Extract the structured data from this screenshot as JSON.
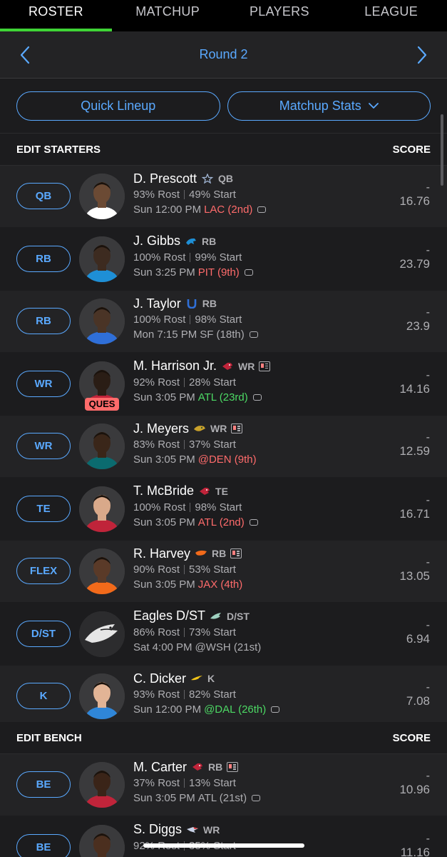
{
  "tabs": [
    {
      "label": "ROSTER",
      "active": true
    },
    {
      "label": "MATCHUP",
      "active": false
    },
    {
      "label": "PLAYERS",
      "active": false
    },
    {
      "label": "LEAGUE",
      "active": false
    }
  ],
  "round": {
    "title": "Round 2"
  },
  "actions": {
    "quick_lineup": "Quick Lineup",
    "matchup_stats": "Matchup Stats"
  },
  "starters_header": {
    "title": "EDIT STARTERS",
    "score": "SCORE"
  },
  "bench_header": {
    "title": "EDIT BENCH",
    "score": "SCORE"
  },
  "colors": {
    "accent": "#5aa9ff",
    "active_tab": "#3fd436",
    "red": "#ff6b6b",
    "green": "#4cd964"
  },
  "starters": [
    {
      "slot": "QB",
      "name": "D. Prescott",
      "team_icon": "cowboys-star-icon",
      "pos": "QB",
      "news": false,
      "rost": "93% Rost",
      "start": "49% Start",
      "time": "Sun 12:00 PM",
      "opp": "LAC (2nd)",
      "opp_color": "red",
      "controller": true,
      "live": "-",
      "proj": "16.76",
      "status": ""
    },
    {
      "slot": "RB",
      "name": "J. Gibbs",
      "team_icon": "lions-icon",
      "pos": "RB",
      "news": false,
      "rost": "100% Rost",
      "start": "99% Start",
      "time": "Sun 3:25 PM",
      "opp": "PIT (9th)",
      "opp_color": "red",
      "controller": true,
      "live": "-",
      "proj": "23.79",
      "status": ""
    },
    {
      "slot": "RB",
      "name": "J. Taylor",
      "team_icon": "colts-horseshoe-icon",
      "pos": "RB",
      "news": false,
      "rost": "100% Rost",
      "start": "98% Start",
      "time": "Mon 7:15 PM",
      "opp": "SF (18th)",
      "opp_color": "gray",
      "controller": true,
      "live": "-",
      "proj": "23.9",
      "status": ""
    },
    {
      "slot": "WR",
      "name": "M. Harrison Jr.",
      "team_icon": "cardinals-icon",
      "pos": "WR",
      "news": true,
      "rost": "92% Rost",
      "start": "28% Start",
      "time": "Sun 3:05 PM",
      "opp": "ATL (23rd)",
      "opp_color": "green",
      "controller": true,
      "live": "-",
      "proj": "14.16",
      "status": "QUES"
    },
    {
      "slot": "WR",
      "name": "J. Meyers",
      "team_icon": "jaguars-icon",
      "pos": "WR",
      "news": true,
      "rost": "83% Rost",
      "start": "37% Start",
      "time": "Sun 3:05 PM",
      "opp": "@DEN (9th)",
      "opp_color": "red",
      "controller": false,
      "live": "-",
      "proj": "12.59",
      "status": ""
    },
    {
      "slot": "TE",
      "name": "T. McBride",
      "team_icon": "cardinals-icon",
      "pos": "TE",
      "news": false,
      "rost": "100% Rost",
      "start": "98% Start",
      "time": "Sun 3:05 PM",
      "opp": "ATL (2nd)",
      "opp_color": "red",
      "controller": true,
      "live": "-",
      "proj": "16.71",
      "status": ""
    },
    {
      "slot": "FLEX",
      "name": "R. Harvey",
      "team_icon": "broncos-icon",
      "pos": "RB",
      "news": true,
      "rost": "90% Rost",
      "start": "53% Start",
      "time": "Sun 3:05 PM",
      "opp": "JAX (4th)",
      "opp_color": "red",
      "controller": false,
      "live": "-",
      "proj": "13.05",
      "status": ""
    },
    {
      "slot": "D/ST",
      "name": "Eagles D/ST",
      "team_icon": "eagles-icon",
      "pos": "D/ST",
      "news": false,
      "rost": "86% Rost",
      "start": "73% Start",
      "time": "Sat 4:00 PM",
      "opp": "@WSH (21st)",
      "opp_color": "gray",
      "controller": false,
      "live": "-",
      "proj": "6.94",
      "status": ""
    },
    {
      "slot": "K",
      "name": "C. Dicker",
      "team_icon": "chargers-bolt-icon",
      "pos": "K",
      "news": false,
      "rost": "93% Rost",
      "start": "82% Start",
      "time": "Sun 12:00 PM",
      "opp": "@DAL (26th)",
      "opp_color": "green",
      "controller": true,
      "live": "-",
      "proj": "7.08",
      "status": ""
    }
  ],
  "bench": [
    {
      "slot": "BE",
      "name": "M. Carter",
      "team_icon": "cardinals-icon",
      "pos": "RB",
      "news": true,
      "rost": "37% Rost",
      "start": "13% Start",
      "time": "Sun 3:05 PM",
      "opp": "ATL (21st)",
      "opp_color": "gray",
      "controller": true,
      "live": "-",
      "proj": "10.96",
      "status": ""
    },
    {
      "slot": "BE",
      "name": "S. Diggs",
      "team_icon": "patriots-icon",
      "pos": "WR",
      "news": false,
      "rost": "92% Rost",
      "start": "35% Start",
      "time": "",
      "opp": "",
      "opp_color": "gray",
      "controller": false,
      "live": "-",
      "proj": "11.16",
      "status": ""
    }
  ]
}
